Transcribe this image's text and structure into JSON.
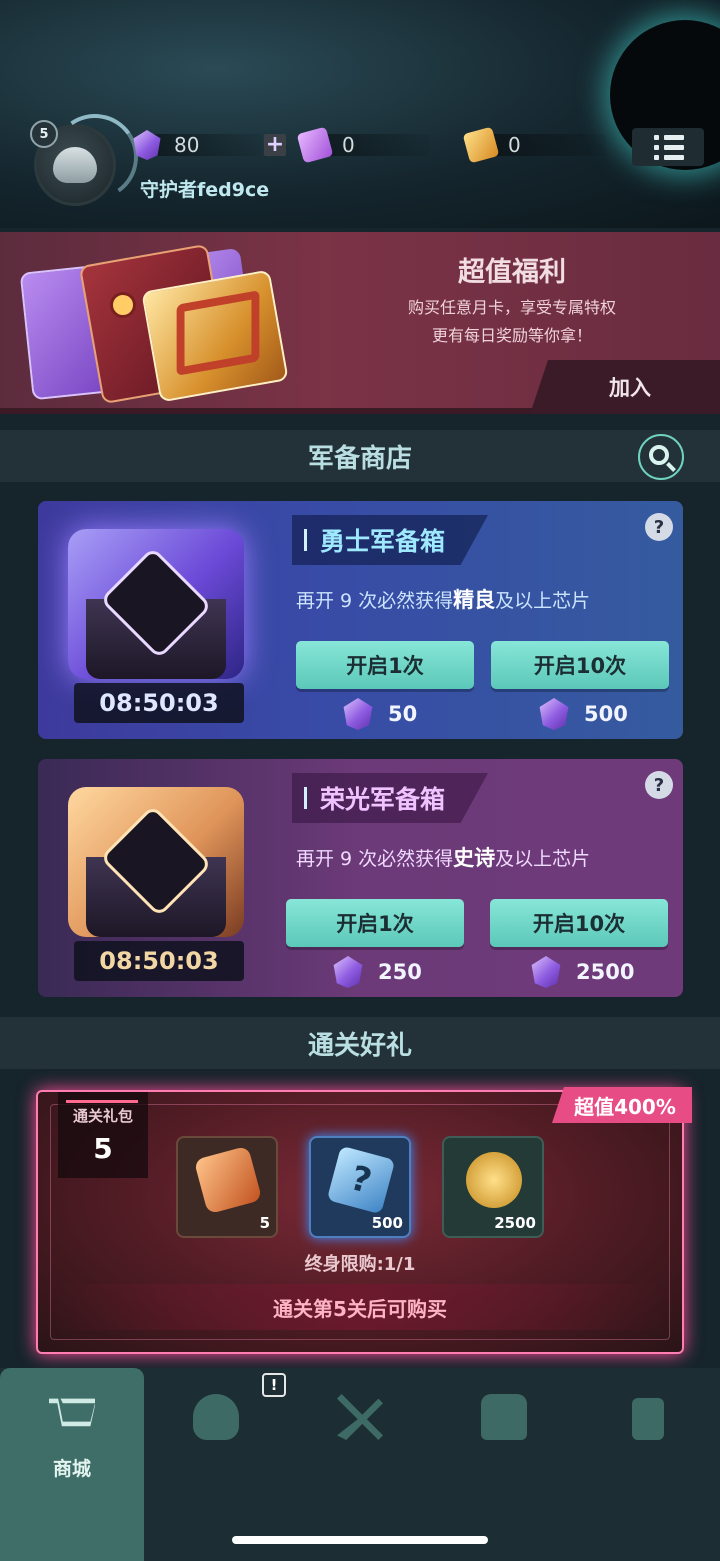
{
  "player": {
    "level": "5",
    "name": "守护者fed9ce"
  },
  "resources": {
    "gems": "80",
    "purple_tickets": "0",
    "gold_tickets": "0",
    "add_symbol": "+"
  },
  "promo": {
    "title": "超值福利",
    "line1": "购买任意月卡，享受专属特权",
    "line2": "更有每日奖励等你拿！",
    "join_label": "加入"
  },
  "shop": {
    "title": "军备商店",
    "crates": [
      {
        "name": "勇士军备箱",
        "timer": "08:50:03",
        "desc_prefix": "再开 9 次必然获得",
        "desc_rarity": "精良",
        "desc_suffix": "及以上芯片",
        "help": "?",
        "open1_label": "开启1次",
        "open10_label": "开启10次",
        "cost1": "50",
        "cost10": "500"
      },
      {
        "name": "荣光军备箱",
        "timer": "08:50:03",
        "desc_prefix": "再开 9 次必然获得",
        "desc_rarity": "史诗",
        "desc_suffix": "及以上芯片",
        "help": "?",
        "open1_label": "开启1次",
        "open10_label": "开启10次",
        "cost1": "250",
        "cost10": "2500"
      }
    ]
  },
  "clear_bonus": {
    "title": "通关好礼",
    "pack_label": "通关礼包",
    "pack_number": "5",
    "value_tag": "超值400%",
    "rewards": [
      {
        "icon": "ticket-icon",
        "count": "5"
      },
      {
        "icon": "mystery-box-icon",
        "count": "500",
        "glyph": "?"
      },
      {
        "icon": "gold-coin-icon",
        "count": "2500"
      }
    ],
    "limit": "终身限购:1/1",
    "unlock_note": "通关第5关后可购买"
  },
  "tabbar": {
    "tabs": [
      {
        "icon": "cart-icon",
        "label": "商城",
        "active": true
      },
      {
        "icon": "helmet-icon",
        "label": "",
        "alert": "!"
      },
      {
        "icon": "swords-icon",
        "label": ""
      },
      {
        "icon": "robot-icon",
        "label": ""
      },
      {
        "icon": "lock-icon",
        "label": ""
      }
    ]
  },
  "colors": {
    "accent_teal": "#6fd3bf",
    "promo_bg": "#7b3346",
    "value_tag": "#e84c85"
  }
}
